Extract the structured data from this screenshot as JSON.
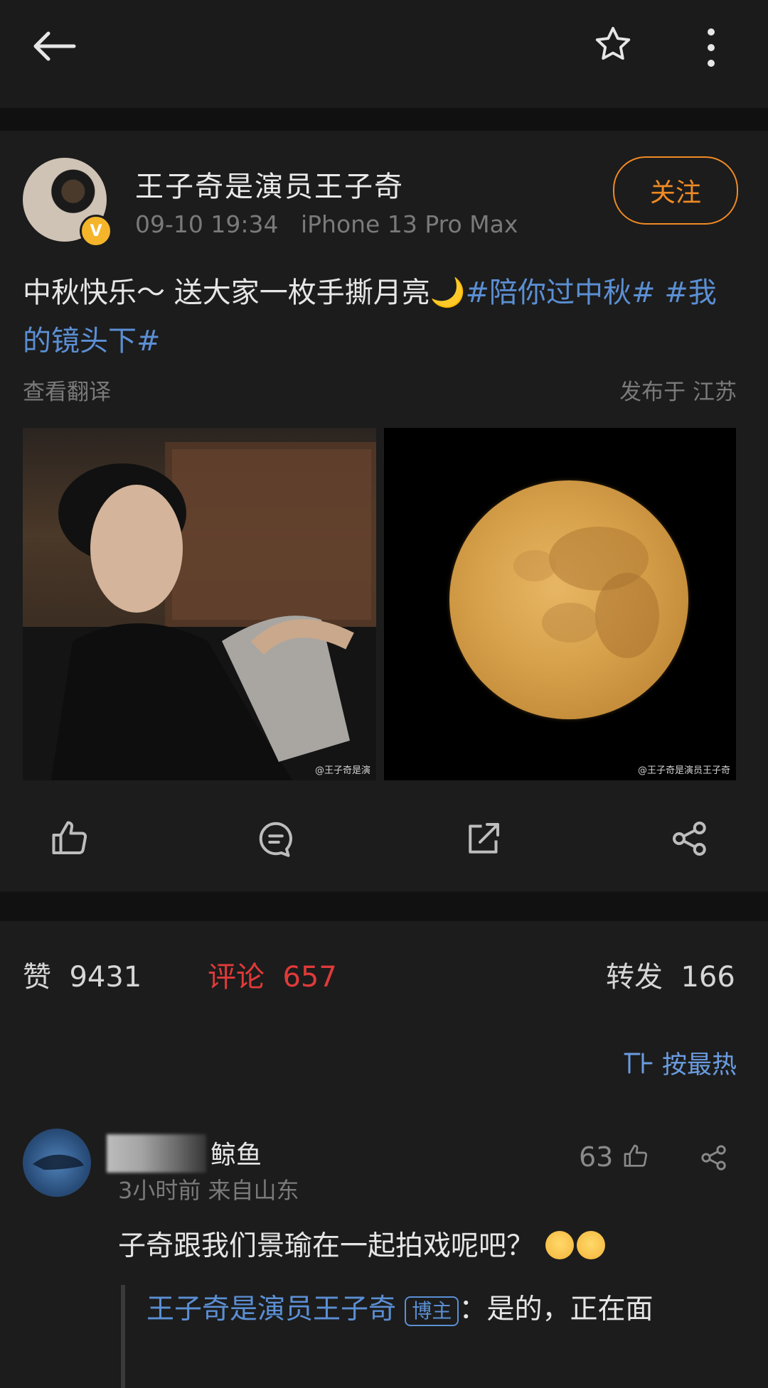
{
  "topbar": {
    "back_icon": "arrow-left-icon",
    "star_icon": "star-icon",
    "more_icon": "more-vertical-icon"
  },
  "post": {
    "author": "王子奇是演员王子奇",
    "verified_badge": "V",
    "time": "09-10 19:34",
    "device": "iPhone 13 Pro Max",
    "follow_label": "关注",
    "text_prefix": "中秋快乐～ 送大家一枚手撕月亮",
    "moon_emoji": "🌙",
    "tag1": "#陪你过中秋#",
    "tag2": "#我的镜头下#",
    "translate_label": "查看翻译",
    "location": "发布于 江苏",
    "image1_watermark": "@王子奇是演",
    "image2_watermark": "@王子奇是演员王子奇"
  },
  "actions": [
    "like-icon",
    "comment-icon",
    "repost-icon",
    "share-icon"
  ],
  "stats": {
    "likes_label": "赞",
    "likes_count": "9431",
    "comments_label": "评论",
    "comments_count": "657",
    "reposts_label": "转发",
    "reposts_count": "166",
    "sort_label": "按最热"
  },
  "comment": {
    "user_suffix": "鲸鱼",
    "time_location": "3小时前  来自山东",
    "like_count": "63",
    "text": "子奇跟我们景瑜在一起拍戏呢吧？",
    "reply_name": "王子奇是演员王子奇",
    "reply_badge": "博主",
    "reply_text": "：是的，正在面"
  },
  "colors": {
    "accent_orange": "#f08a24",
    "link_blue": "#5b8fd4",
    "comment_red": "#e03a3a"
  }
}
